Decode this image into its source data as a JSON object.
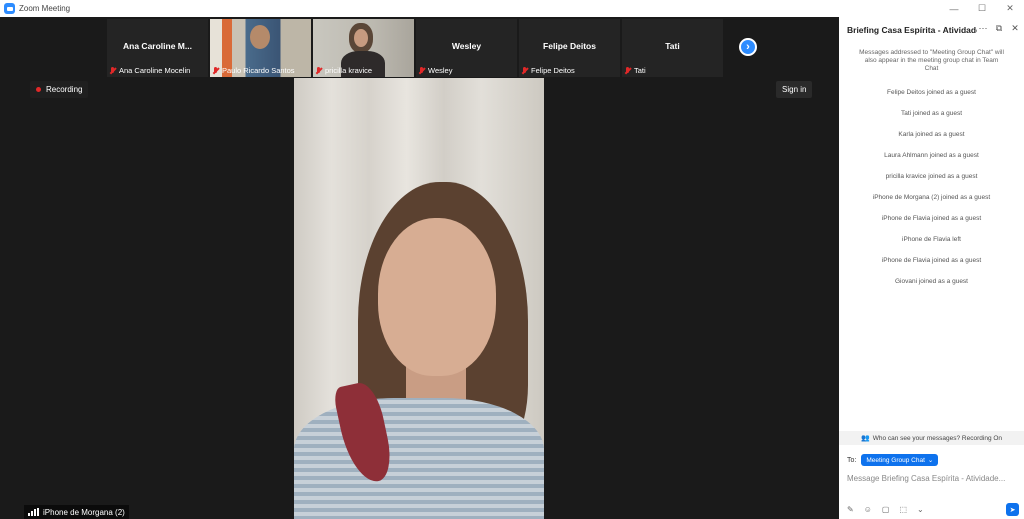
{
  "window": {
    "title": "Zoom Meeting",
    "minimize": "—",
    "maximize": "☐",
    "close": "✕"
  },
  "gallery": [
    {
      "display": "Ana Caroline M...",
      "label": "Ana Caroline Mocelin",
      "video": false
    },
    {
      "display": "",
      "label": "Paulo Ricardo Santos",
      "video": true
    },
    {
      "display": "",
      "label": "pricilla kravice",
      "video": true
    },
    {
      "display": "Wesley",
      "label": "Wesley",
      "video": false
    },
    {
      "display": "Felipe Deitos",
      "label": "Felipe Deitos",
      "video": false
    },
    {
      "display": "Tati",
      "label": "Tati",
      "video": false
    }
  ],
  "recording": {
    "label": "Recording"
  },
  "signin": {
    "label": "Sign in"
  },
  "speaker": {
    "label": "iPhone de Morgana (2)"
  },
  "chat": {
    "title": "Briefing Casa Espírita - Atividade...",
    "notice": "Messages addressed to \"Meeting Group Chat\" will also appear in the meeting group chat in Team Chat",
    "events": [
      "Felipe Deitos joined as a guest",
      "Tati joined as a guest",
      "Karla joined as a guest",
      "Laura Ahlmann joined as a guest",
      "pricilla kravice joined as a guest",
      "iPhone de Morgana (2) joined as a guest",
      "iPhone de Flavia joined as a guest",
      "iPhone de Flavia left",
      "iPhone de Flavia joined as a guest",
      "Giovani joined as a guest"
    ],
    "who_can_see": "Who can see your messages? Recording On",
    "to_label": "To:",
    "recipient": "Meeting Group Chat",
    "input_placeholder": "Message Briefing Casa Espírita - Atividade..."
  },
  "icons": {
    "more": "⋯",
    "popout": "⧉",
    "close": "✕",
    "next": "›",
    "people": "👥",
    "chevron": "⌄",
    "send": "➤"
  }
}
